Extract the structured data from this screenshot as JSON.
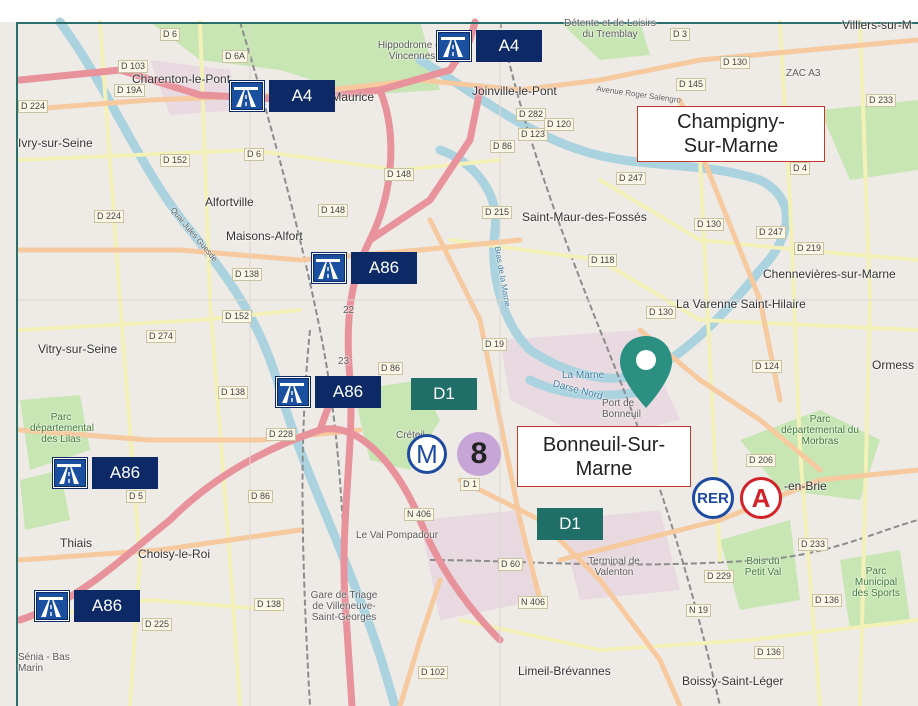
{
  "map": {
    "colors": {
      "background": "#eeeae6",
      "highway": "#e8929c",
      "primary": "#f7c99e",
      "secondary": "#f3f1b8",
      "water": "#aad3df",
      "park": "#c8e6b4",
      "rail": "#8c8c8c",
      "highway_tag": "#0d2a66",
      "d_tag": "#1f6e68",
      "pin": "#2b8f82",
      "frame": "#2b6e6a"
    },
    "place_labels": [
      {
        "id": "charenton",
        "text": "Charenton-le-Pont"
      },
      {
        "id": "saint-maurice",
        "text": "Saint-Maurice"
      },
      {
        "id": "joinville",
        "text": "Joinville-le-Pont"
      },
      {
        "id": "ivry",
        "text": "Ivry-sur-Seine"
      },
      {
        "id": "alfortville",
        "text": "Alfortville"
      },
      {
        "id": "maisons-alfort",
        "text": "Maisons-Alfort"
      },
      {
        "id": "saint-maur",
        "text": "Saint-Maur-des-Fossés"
      },
      {
        "id": "chennevieres",
        "text": "Chennevières-sur-Marne"
      },
      {
        "id": "varenne",
        "text": "La Varenne Saint-Hilaire"
      },
      {
        "id": "vitry",
        "text": "Vitry-sur-Seine"
      },
      {
        "id": "ormesson",
        "text": "Ormess"
      },
      {
        "id": "creteil",
        "text": "Créteil"
      },
      {
        "id": "thiais",
        "text": "Thiais"
      },
      {
        "id": "choisy",
        "text": "Choisy-le-Roi"
      },
      {
        "id": "val-pompadour",
        "text": "Le Val Pompadour"
      },
      {
        "id": "limeil",
        "text": "Limeil-Brévannes"
      },
      {
        "id": "boissy",
        "text": "Boissy-Saint-Léger"
      },
      {
        "id": "en-brie",
        "text": "-en-Brie"
      },
      {
        "id": "villiers",
        "text": "Villiers-sur-M"
      },
      {
        "id": "zac",
        "text": "ZAC A3"
      }
    ],
    "minor_labels": [
      {
        "id": "hippodrome",
        "text": "Hippodrome de Vincennes"
      },
      {
        "id": "loisirs",
        "text": "Détente et de Loisirs du Tremblay"
      },
      {
        "id": "port-bonneuil",
        "text": "Port de Bonneuil"
      },
      {
        "id": "la-marne",
        "text": "La Marne"
      },
      {
        "id": "darse",
        "text": "Darse Nord"
      },
      {
        "id": "terminal",
        "text": "Terminal de Valenton"
      },
      {
        "id": "gare-triage",
        "text": "Gare de Triage de Villeneuve-Saint-Georges"
      },
      {
        "id": "senia",
        "text": "Sénia - Bas Marin"
      },
      {
        "id": "av-roger",
        "text": "Avenue Roger Salengro"
      },
      {
        "id": "bras-marne",
        "text": "Bras de la Marne"
      },
      {
        "id": "quai",
        "text": "Quai Jules Guesde"
      }
    ],
    "park_labels": [
      {
        "id": "parc-lilas",
        "text": "Parc départemental des Lilas"
      },
      {
        "id": "parc-morbras",
        "text": "Parc départemental du Morbras"
      },
      {
        "id": "bois-petit-val",
        "text": "Bois du Petit Val"
      },
      {
        "id": "parc-sports",
        "text": "Parc Municipal des Sports"
      }
    ],
    "road_labels": [
      "D 6",
      "D 6A",
      "D 103",
      "D 19A",
      "D 224",
      "D 152",
      "D 6",
      "D 148",
      "D 148",
      "D 224",
      "D 138",
      "D 152",
      "D 274",
      "D 138",
      "D 228",
      "D 5",
      "D 86",
      "D 86",
      "D 19",
      "D 1",
      "D 138",
      "D 225",
      "D 102",
      "D 60",
      "N 406",
      "N 406",
      "D 215",
      "D 118",
      "D 130",
      "D 130",
      "D 247",
      "D 247",
      "D 4",
      "D 145",
      "D 130",
      "D 3",
      "D 233",
      "D 219",
      "D 124",
      "D 206",
      "D 233",
      "D 229",
      "N 19",
      "D 136",
      "D 136",
      "D 282",
      "D 86",
      "D 123",
      "D 120",
      "22",
      "23"
    ],
    "highways": [
      {
        "id": "a4-top",
        "label": "A4"
      },
      {
        "id": "a4-left",
        "label": "A4"
      },
      {
        "id": "a86-upper",
        "label": "A86"
      },
      {
        "id": "a86-mid",
        "label": "A86"
      },
      {
        "id": "a86-left",
        "label": "A86"
      },
      {
        "id": "a86-bottom",
        "label": "A86"
      }
    ],
    "departmental": [
      {
        "id": "d1-upper",
        "label": "D1"
      },
      {
        "id": "d1-lower",
        "label": "D1"
      }
    ],
    "cities": [
      {
        "id": "champigny",
        "line1": "Champigny-",
        "line2": "Sur-Marne"
      },
      {
        "id": "bonneuil",
        "line1": "Bonneuil-Sur-",
        "line2": "Marne"
      }
    ],
    "transit": {
      "metro_symbol": "M",
      "metro_line": "8",
      "rer_label": "RER",
      "rer_line": "A"
    },
    "pin_icon": "map-pin-icon",
    "highway_icon": "motorway-icon"
  }
}
